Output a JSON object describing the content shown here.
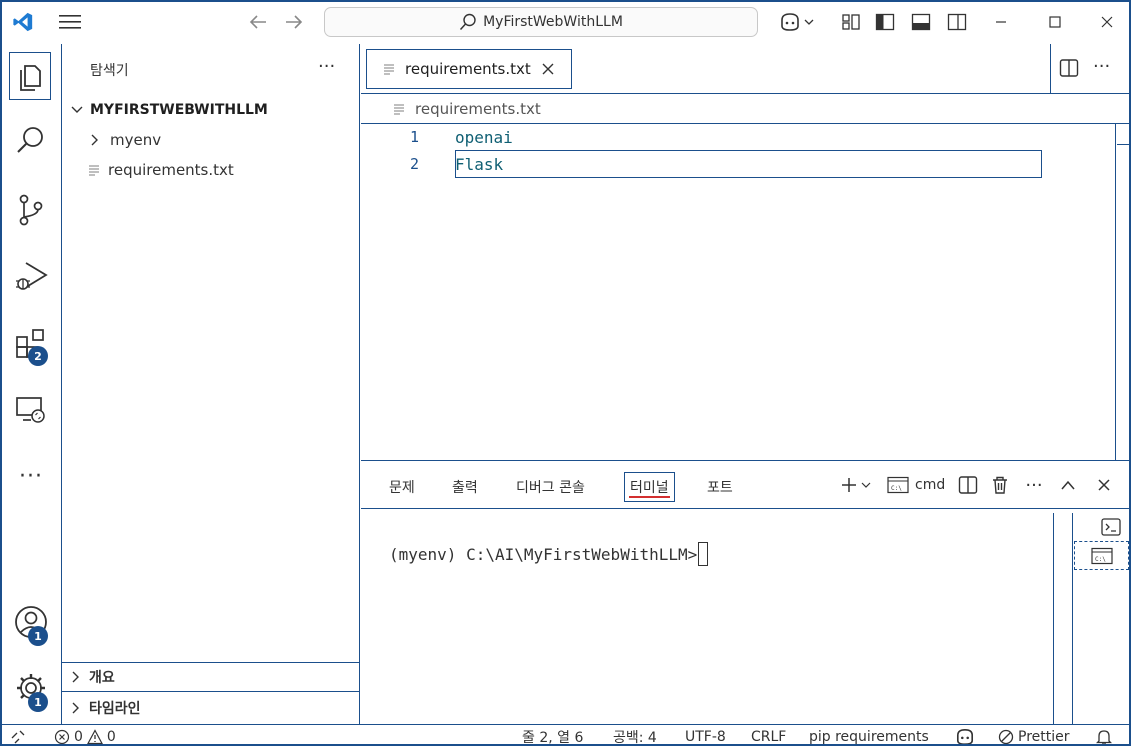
{
  "titlebar": {
    "search_text": "MyFirstWebWithLLM"
  },
  "activity": {
    "extensions_badge": "2",
    "accounts_badge": "1",
    "manage_badge": "1"
  },
  "sidebar": {
    "title": "탐색기",
    "more": "···",
    "root_folder": "MYFIRSTWEBWITHLLM",
    "items": [
      {
        "label": "myenv",
        "type": "folder"
      },
      {
        "label": "requirements.txt",
        "type": "file"
      }
    ],
    "outline_label": "개요",
    "timeline_label": "타임라인"
  },
  "editor": {
    "tab_label": "requirements.txt",
    "breadcrumb": "requirements.txt",
    "lines": [
      {
        "num": "1",
        "text": "openai"
      },
      {
        "num": "2",
        "text": "Flask"
      }
    ]
  },
  "panel": {
    "tabs": [
      "문제",
      "출력",
      "디버그 콘솔",
      "터미널",
      "포트"
    ],
    "active_tab": "터미널",
    "shell_label": "cmd",
    "terminal_line": "(myenv) C:\\AI\\MyFirstWebWithLLM>"
  },
  "status": {
    "errors": "0",
    "warnings": "0",
    "position": "줄 2, 열 6",
    "spaces": "공백: 4",
    "encoding": "UTF-8",
    "eol": "CRLF",
    "language": "pip requirements",
    "formatter": "Prettier"
  },
  "colors": {
    "accent": "#1b4f8c",
    "code_text": "#0f5f73",
    "active_tab_underline": "#d32f2f"
  }
}
